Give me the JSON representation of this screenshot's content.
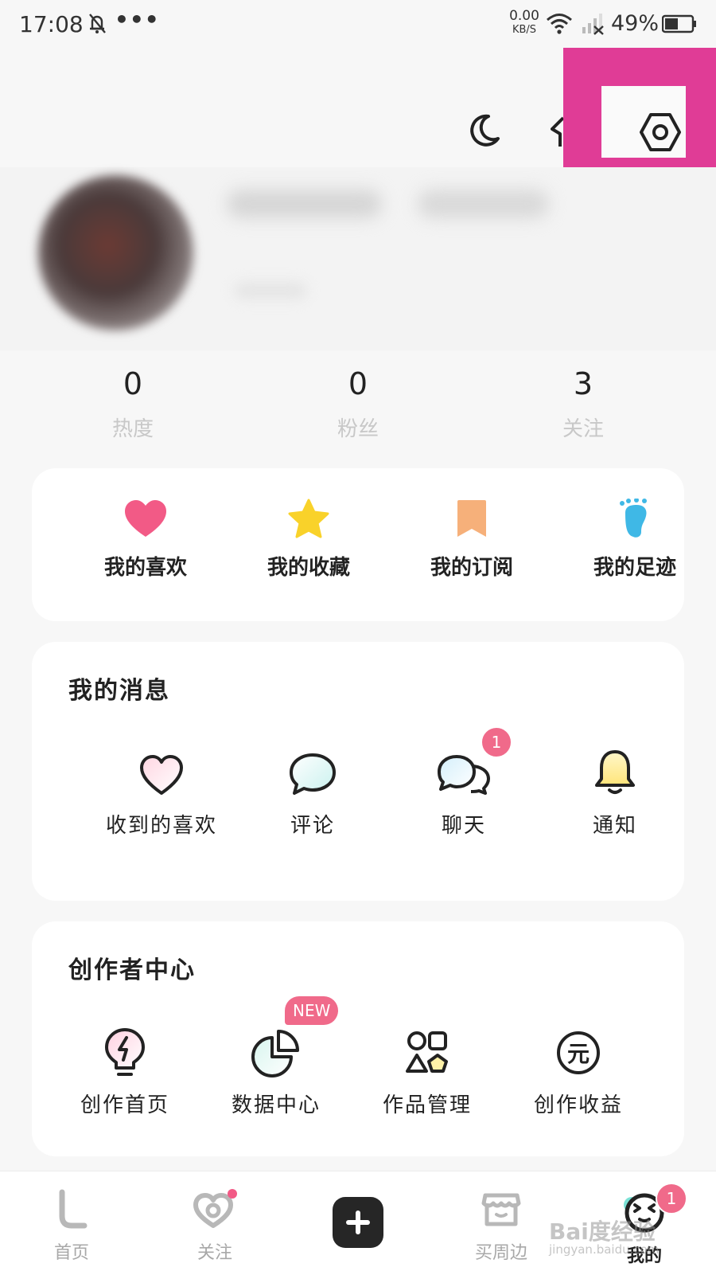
{
  "status_bar": {
    "time": "17:08",
    "dots": "•••",
    "net_speed": "0.00",
    "net_unit": "KB/S",
    "battery": "49%"
  },
  "header": {
    "icons": [
      "moon-icon",
      "shirt-icon",
      "settings-icon"
    ]
  },
  "stats": [
    {
      "value": "0",
      "label": "热度"
    },
    {
      "value": "0",
      "label": "粉丝"
    },
    {
      "value": "3",
      "label": "关注"
    }
  ],
  "quick_access": [
    {
      "label": "我的喜欢",
      "icon": "heart-icon",
      "color": "#f25a86"
    },
    {
      "label": "我的收藏",
      "icon": "star-icon",
      "color": "#f9d22a"
    },
    {
      "label": "我的订阅",
      "icon": "bookmark-icon",
      "color": "#f6b07a"
    },
    {
      "label": "我的足迹",
      "icon": "footprint-icon",
      "color": "#3fb8e6"
    }
  ],
  "messages": {
    "title": "我的消息",
    "items": [
      {
        "label": "收到的喜欢",
        "icon": "heart-outline-icon"
      },
      {
        "label": "评论",
        "icon": "comment-icon"
      },
      {
        "label": "聊天",
        "icon": "chat-icon",
        "badge": "1"
      },
      {
        "label": "通知",
        "icon": "bell-icon"
      }
    ]
  },
  "creator": {
    "title": "创作者中心",
    "items": [
      {
        "label": "创作首页",
        "icon": "lightbulb-icon"
      },
      {
        "label": "数据中心",
        "icon": "pie-chart-icon",
        "badge": "NEW"
      },
      {
        "label": "作品管理",
        "icon": "shapes-icon"
      },
      {
        "label": "创作收益",
        "icon": "yuan-icon",
        "glyph": "元"
      }
    ]
  },
  "bottom_nav": [
    {
      "label": "首页",
      "icon": "home-icon"
    },
    {
      "label": "关注",
      "icon": "follow-heart-icon"
    },
    {
      "label": "",
      "icon": "add-icon"
    },
    {
      "label": "买周边",
      "icon": "shop-icon"
    },
    {
      "label": "我的",
      "icon": "profile-face-icon",
      "badge": "1",
      "active": true
    }
  ],
  "watermark": {
    "text": "Bai度经验",
    "sub": "jingyan.baidu.com"
  },
  "colors": {
    "highlight": "#e03c96",
    "badge": "#f06a8a"
  }
}
